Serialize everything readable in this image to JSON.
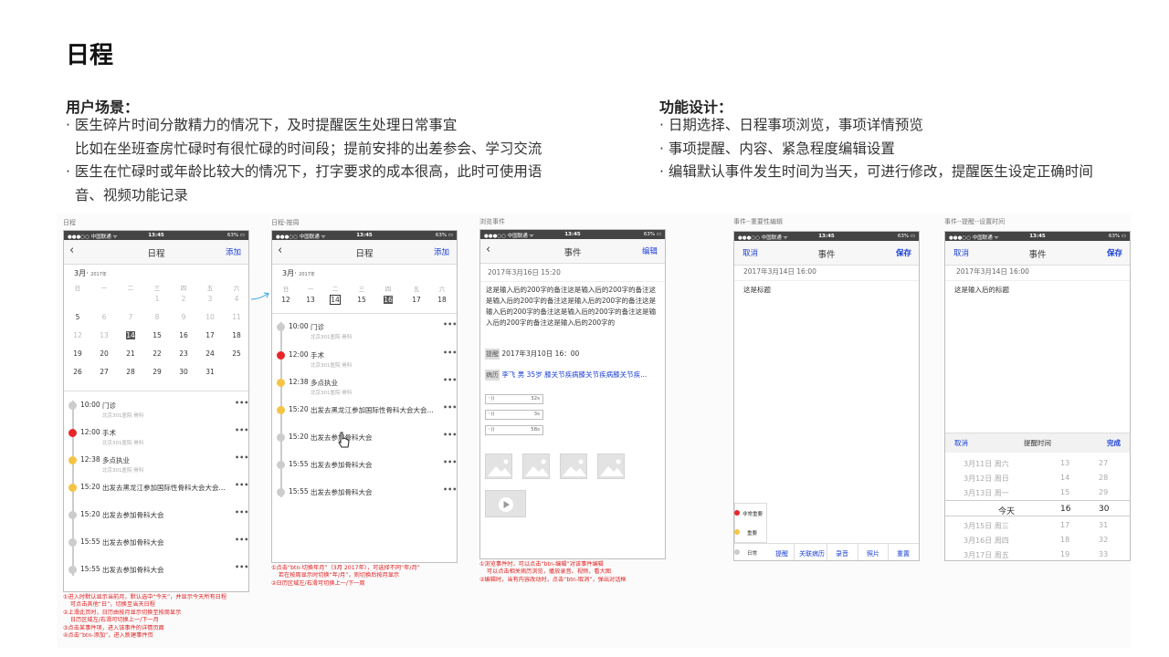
{
  "page": {
    "title": "日程",
    "scenario": {
      "heading": "用户场景：",
      "lines": [
        "· 医生碎片时间分散精力的情况下，及时提醒医生处理日常事宜",
        "  比如在坐班查房忙碌时有很忙碌的时间段；提前安排的出差参会、学习交流",
        "· 医生在忙碌时或年龄比较大的情况下，打字要求的成本很高，此时可使用语",
        "  音、视频功能记录"
      ]
    },
    "design": {
      "heading": "功能设计：",
      "lines": [
        "· 日期选择、日程事项浏览，事项详情预览",
        "· 事项提醒、内容、紧急程度编辑设置",
        "· 编辑默认事件发生时间为当天，可进行修改，提醒医生设定正确时间"
      ]
    }
  },
  "status_bar": {
    "carrier": "●●●○○ 中国联通 ᯤ",
    "time": "13:45",
    "battery": "63% ▭"
  },
  "screen1": {
    "label": "日程",
    "title": "日程",
    "right": "添加",
    "month": "3月",
    "year": "2017年",
    "weekdays": [
      "日",
      "一",
      "二",
      "三",
      "四",
      "五",
      "六"
    ],
    "rows": [
      [
        "",
        "",
        "",
        "1",
        "2",
        "3",
        "4"
      ],
      [
        "5",
        "6",
        "7",
        "8",
        "9",
        "10",
        "11"
      ],
      [
        "12",
        "13",
        "14",
        "15",
        "16",
        "17",
        "18"
      ],
      [
        "19",
        "20",
        "21",
        "22",
        "23",
        "24",
        "25"
      ],
      [
        "26",
        "27",
        "28",
        "29",
        "30",
        "31",
        ""
      ]
    ],
    "events": [
      {
        "time": "10:00",
        "name": "门诊",
        "sub": "北京301医院  骨科"
      },
      {
        "time": "12:00",
        "name": "手术",
        "sub": "北京301医院  骨科"
      },
      {
        "time": "12:38",
        "name": "多点执业",
        "sub": "北京301医院  骨科"
      },
      {
        "time": "15:20",
        "name": "出发去黑龙江参加国际性骨科大会大会...",
        "sub": ""
      },
      {
        "time": "15:20",
        "name": "出发去参加骨科大会",
        "sub": ""
      },
      {
        "time": "15:55",
        "name": "出发去参加骨科大会",
        "sub": ""
      },
      {
        "time": "15:55",
        "name": "出发去参加骨科大会",
        "sub": ""
      }
    ],
    "more": "•••",
    "notes": [
      "①进入时默认显示当前月，默认选中“今天”，并显示今天所有日程",
      "    可点击其他“日”，切换至当天日程",
      "②上滑此页时，日历由按月显示切换至按周显示",
      "    日历区域左/右滑可切换上一/下一月",
      "③点击某事件项，进入该事件的详情页面",
      "④点击“btn-添加”，进入新建事件页"
    ]
  },
  "screen2": {
    "label": "日程-按周",
    "title": "日程",
    "right": "添加",
    "month": "3月",
    "year": "2017年",
    "weekdays": [
      "日",
      "一",
      "二",
      "三",
      "四",
      "五",
      "六"
    ],
    "week": [
      "12",
      "13",
      "14",
      "15",
      "16",
      "17",
      "18"
    ],
    "events": [
      {
        "time": "10:00",
        "name": "门诊",
        "sub": "北京301医院  骨科"
      },
      {
        "time": "12:00",
        "name": "手术",
        "sub": "北京301医院  骨科"
      },
      {
        "time": "12:38",
        "name": "多点执业",
        "sub": "北京301医院  骨科"
      },
      {
        "time": "15:20",
        "name": "出发去黑龙江参加国际性骨科大会大会...",
        "sub": ""
      },
      {
        "time": "15:20",
        "name": "出发去参加骨科大会",
        "sub": ""
      },
      {
        "time": "15:55",
        "name": "出发去参加骨科大会",
        "sub": ""
      },
      {
        "time": "15:55",
        "name": "出发去参加骨科大会",
        "sub": ""
      }
    ],
    "notes": [
      "①点击“btn-切换年月”（3月 2017年），可选择不同“年/月”",
      "    若在按周显示时切换“年/月”，则切换后按月显示",
      "②日历区域左/右滑可切换上一/下一周"
    ]
  },
  "screen3": {
    "label": "浏览事件",
    "title": "事件",
    "right": "编辑",
    "date": "2017年3月16日 15:20",
    "body": "这是输入后的200字的备注这是输入后的200字的备注这是输入后的200字的备注这是输入后的200字的备注这是输入后的200字的备注这是输入后的200字的备注这是输入后的200字的备注这是输入后的200字的",
    "remind_tag": "提醒",
    "remind": "2017年3月10日  16：00",
    "record_tag": "病历",
    "record": "李飞  男  35岁  膝关节疾病膝关节疾病膝关节疾...",
    "voices": [
      "32s",
      "3s",
      "58s"
    ],
    "notes": [
      "①浏览事件时，可以点击“btn-编辑”对该事件编辑",
      "    可以点击相关病历浏览，播放录音、视频，看大图",
      "②编辑时，当有内容改动时，点击“btn-取消”，弹出对话框"
    ]
  },
  "screen4": {
    "label": "事件--重要性编辑",
    "left": "取消",
    "title": "事件",
    "right": "保存",
    "date": "2017年3月14日 16:00",
    "text": "这是标题",
    "levels": [
      "非常重要",
      "重要",
      "日常"
    ],
    "tabs": [
      "提醒",
      "关联病历",
      "录音",
      "照片",
      "重置"
    ]
  },
  "screen5": {
    "label": "事件--提醒--设置时间",
    "left": "取消",
    "title": "事件",
    "right": "保存",
    "date": "2017年3月14日 16:00",
    "text": "这是输入后的标题",
    "picker_cancel": "取消",
    "picker_title": "提醒时间",
    "picker_done": "完成",
    "picker_rows": [
      [
        "3月11日 周六",
        "13",
        "27"
      ],
      [
        "3月12日 周日",
        "14",
        "28"
      ],
      [
        "3月13日 周一",
        "15",
        "29"
      ],
      [
        "今天",
        "16",
        "30"
      ],
      [
        "3月15日 周三",
        "17",
        "31"
      ],
      [
        "3月16日 周四",
        "18",
        "32"
      ],
      [
        "3月17日 周五",
        "19",
        "33"
      ]
    ]
  },
  "colors": {
    "accent": "#1a3fd6",
    "urgent": "#e8262a",
    "important": "#f5c445",
    "note": "#e02020"
  }
}
